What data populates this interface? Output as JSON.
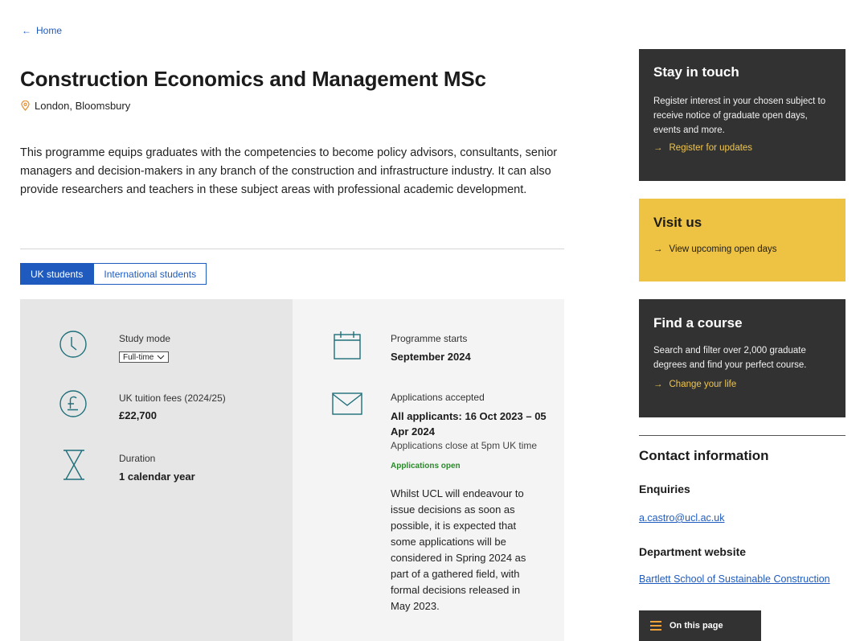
{
  "breadcrumb": {
    "arrow": "←",
    "home_label": "Home"
  },
  "page": {
    "title": "Construction Economics and Management MSc",
    "location": "London, Bloomsbury",
    "intro": "This programme equips graduates with the competencies to become policy advisors, consultants, senior managers and decision-makers in any branch of the construction and infrastructure industry. It can also provide researchers and teachers in these subject areas with professional academic development."
  },
  "tabs": [
    {
      "label": "UK students",
      "active": true
    },
    {
      "label": "International students",
      "active": false
    }
  ],
  "info": {
    "study_mode": {
      "label": "Study mode",
      "selected": "Full-time",
      "icon": "clock-icon"
    },
    "fees": {
      "label": "UK tuition fees (2024/25)",
      "value": "£22,700",
      "icon": "pound-icon"
    },
    "duration": {
      "label": "Duration",
      "value": "1 calendar year",
      "icon": "hourglass-icon"
    },
    "starts": {
      "label": "Programme starts",
      "value": "September 2024",
      "icon": "calendar-icon"
    },
    "applications": {
      "label": "Applications accepted",
      "value": "All applicants: 16 Oct 2023 – 05 Apr 2024",
      "close": "Applications close at 5pm UK time",
      "status": "Applications open",
      "note": "Whilst UCL will endeavour to issue decisions as soon as possible, it is expected that some applications will be considered in Spring 2024 as part of a gathered field, with formal decisions released in May 2023.",
      "icon": "envelope-icon"
    }
  },
  "sidebar": {
    "stay_in_touch": {
      "title": "Stay in touch",
      "text": "Register interest in your chosen subject to receive notice of graduate open days, events and more.",
      "link": "Register for updates"
    },
    "visit_us": {
      "title": "Visit us",
      "link": "View upcoming open days"
    },
    "find_course": {
      "title": "Find a course",
      "text": "Search and filter over 2,000 graduate degrees and find your perfect course.",
      "link": "Change your life"
    },
    "contact": {
      "heading": "Contact information",
      "enquiries_label": "Enquiries",
      "email": "a.castro@ucl.ac.uk",
      "website_label": "Department website",
      "website": "Bartlett School of Sustainable Construction"
    },
    "on_this_page": "On this page"
  },
  "colors": {
    "link_blue": "#1f5bbf",
    "dark_card": "#323232",
    "yellow_card": "#eec242",
    "icon_teal": "#1e6f7a",
    "status_green": "#2a8a2a"
  }
}
